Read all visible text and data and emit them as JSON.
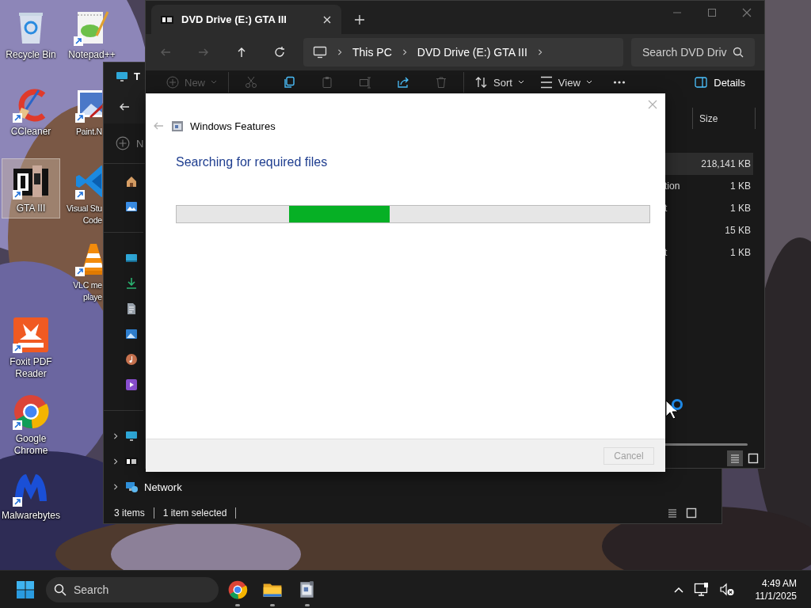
{
  "desktop_icons": [
    {
      "kind": "bin",
      "label": [
        "Recycle Bin"
      ],
      "shortcut": false,
      "selected": false
    },
    {
      "kind": "ccleaner",
      "label": [
        "CCleaner"
      ],
      "shortcut": true,
      "selected": false
    },
    {
      "kind": "gta",
      "label": [
        "GTA III"
      ],
      "shortcut": true,
      "selected": true
    },
    {
      "kind": "foxit",
      "label": [
        "Foxit PDF",
        "Reader"
      ],
      "shortcut": true,
      "selected": false
    },
    {
      "kind": "chrome",
      "label": [
        "Google",
        "Chrome"
      ],
      "shortcut": true,
      "selected": false
    },
    {
      "kind": "malwarebytes",
      "label": [
        "Malwarebytes"
      ],
      "shortcut": true,
      "selected": false
    },
    {
      "kind": "notepad",
      "label": [
        "Notepad++"
      ],
      "shortcut": true,
      "selected": false
    },
    {
      "kind": "paint",
      "label": [
        "Paint.N"
      ],
      "shortcut": true,
      "selected": false
    },
    {
      "kind": "vscode",
      "label": [
        "Visual Stu",
        "Code"
      ],
      "shortcut": true,
      "selected": false
    },
    {
      "kind": "vlc",
      "label": [
        "VLC me",
        "playe"
      ],
      "shortcut": true,
      "selected": false
    }
  ],
  "back_window": {
    "title": "T",
    "toolbar_new": "N",
    "sidebar": [
      [
        {
          "kind": "home",
          "has_children": false
        },
        {
          "kind": "gallery",
          "has_children": false
        }
      ],
      [
        {
          "kind": "desktop",
          "has_children": false
        },
        {
          "kind": "downloads",
          "has_children": false
        },
        {
          "kind": "documents",
          "has_children": false
        },
        {
          "kind": "pictures",
          "has_children": false
        },
        {
          "kind": "music",
          "has_children": false
        },
        {
          "kind": "videos",
          "has_children": false
        }
      ],
      [
        {
          "kind": "pc",
          "has_children": true
        },
        {
          "kind": "disc",
          "has_children": true
        },
        {
          "kind": "network",
          "label": "Network",
          "has_children": true
        }
      ]
    ],
    "status": [
      "3 items",
      "1 item selected"
    ],
    "view_buttons": [
      {
        "kind": "details",
        "selected": false
      },
      {
        "kind": "tiles",
        "selected": false
      }
    ]
  },
  "explorer": {
    "tabs": [
      {
        "title": "DVD Drive (E:) GTA III",
        "selected": true
      }
    ],
    "nav_buttons": [
      {
        "kind": "back",
        "disabled": true
      },
      {
        "kind": "forward",
        "disabled": true
      },
      {
        "kind": "up",
        "disabled": false
      },
      {
        "kind": "refresh",
        "disabled": false
      }
    ],
    "breadcrumb": [
      "This PC",
      "DVD Drive (E:) GTA III"
    ],
    "search": {
      "placeholder": "Search DVD Driv"
    },
    "toolbar": [
      {
        "kind": "new",
        "label": "New",
        "disabled": true
      },
      {
        "kind": "cut",
        "disabled": true
      },
      {
        "kind": "copy",
        "disabled": false
      },
      {
        "kind": "paste",
        "disabled": true
      },
      {
        "kind": "rename",
        "disabled": true
      },
      {
        "kind": "share",
        "disabled": false
      },
      {
        "kind": "delete",
        "disabled": true
      },
      {
        "kind": "sort",
        "label": "Sort",
        "disabled": false
      },
      {
        "kind": "view",
        "label": "View",
        "disabled": false
      },
      {
        "kind": "more",
        "disabled": false
      }
    ],
    "details_button": "Details",
    "columns": [
      "Size"
    ],
    "rows": [
      {
        "size": "218,141 KB",
        "selected": true
      },
      {
        "column_1": "tion",
        "size": "1 KB",
        "selected": false
      },
      {
        "column_1": "t",
        "size": "1 KB",
        "selected": false
      },
      {
        "size": "15 KB",
        "selected": false
      },
      {
        "column_1": "t",
        "size": "1 KB",
        "selected": false
      }
    ],
    "view_buttons": [
      {
        "kind": "details",
        "selected": true
      },
      {
        "kind": "tiles",
        "selected": false
      }
    ]
  },
  "dialog": {
    "title": "Windows Features",
    "heading": "Searching for required files",
    "progress": {
      "kind": "marquee"
    },
    "buttons": [
      {
        "label": "Cancel",
        "disabled": true
      }
    ]
  },
  "taskbar": {
    "search": {
      "placeholder": "Search"
    },
    "apps": [
      {
        "kind": "chrome",
        "running": true
      },
      {
        "kind": "explorer",
        "running": true
      },
      {
        "kind": "features",
        "running": true
      }
    ],
    "time": "4:49 AM",
    "date": "11/1/2025"
  }
}
